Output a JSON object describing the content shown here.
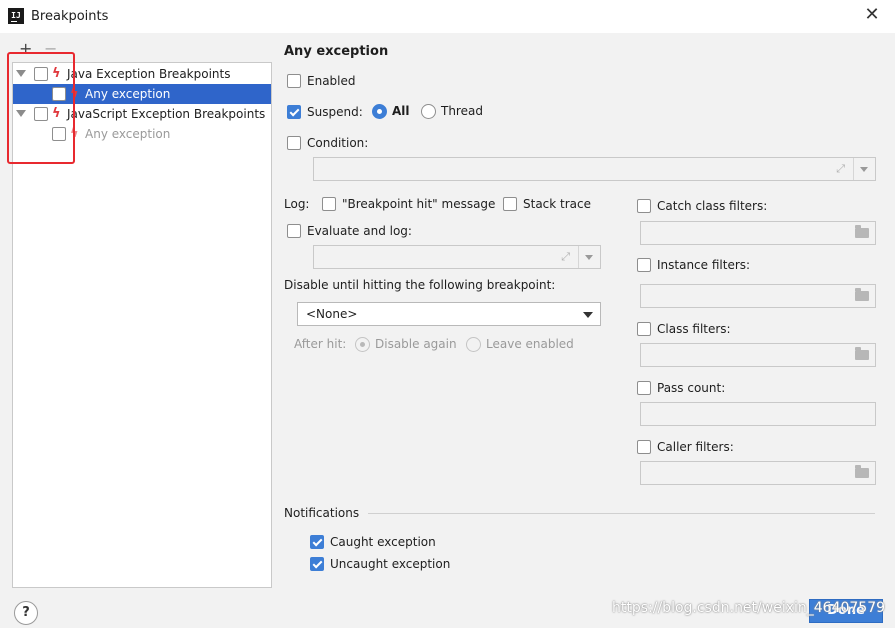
{
  "window": {
    "title": "Breakpoints",
    "app_icon_text": "IJ",
    "close_glyph": "✕"
  },
  "toolbar": {
    "add": "+",
    "remove": "−"
  },
  "tree": [
    {
      "label": "Java Exception Breakpoints",
      "checked": false
    },
    {
      "label": "Any exception",
      "checked": false,
      "selected": true
    },
    {
      "label": "JavaScript Exception Breakpoints",
      "checked": false
    },
    {
      "label": "Any exception",
      "checked": false,
      "disabled": true
    }
  ],
  "details": {
    "title": "Any exception",
    "enabled": {
      "label": "Enabled",
      "checked": false
    },
    "suspend": {
      "label": "Suspend:",
      "checked": true,
      "options": [
        "All",
        "Thread"
      ],
      "selected": "All"
    },
    "condition": {
      "label": "Condition:",
      "checked": false,
      "value": ""
    },
    "log": {
      "label": "Log:",
      "message": {
        "label": "\"Breakpoint hit\" message",
        "checked": false
      },
      "stack_trace": {
        "label": "Stack trace",
        "checked": false
      }
    },
    "evaluate_and_log": {
      "label": "Evaluate and log:",
      "checked": false,
      "value": ""
    },
    "disable_until": {
      "label": "Disable until hitting the following breakpoint:",
      "value": "<None>"
    },
    "after_hit": {
      "label": "After hit:",
      "options": [
        "Disable again",
        "Leave enabled"
      ],
      "selected": "Disable again"
    },
    "filters": [
      {
        "label": "Catch class filters:",
        "checked": false,
        "browse": true
      },
      {
        "label": "Instance filters:",
        "checked": false,
        "browse": true
      },
      {
        "label": "Class filters:",
        "checked": false,
        "browse": true
      },
      {
        "label": "Pass count:",
        "checked": false,
        "browse": false
      },
      {
        "label": "Caller filters:",
        "checked": false,
        "browse": true
      }
    ],
    "notifications": {
      "title": "Notifications",
      "caught": {
        "label": "Caught exception",
        "checked": true
      },
      "uncaught": {
        "label": "Uncaught exception",
        "checked": true
      }
    }
  },
  "footer": {
    "help": "?",
    "done": "Done",
    "watermark": "https://blog.csdn.net/weixin_46407579"
  },
  "colors": {
    "accent": "#3d7ed6",
    "selection": "#2f65ca",
    "highlight_box": "#e8292f",
    "breakpoint_bolt": "#e0393e"
  }
}
